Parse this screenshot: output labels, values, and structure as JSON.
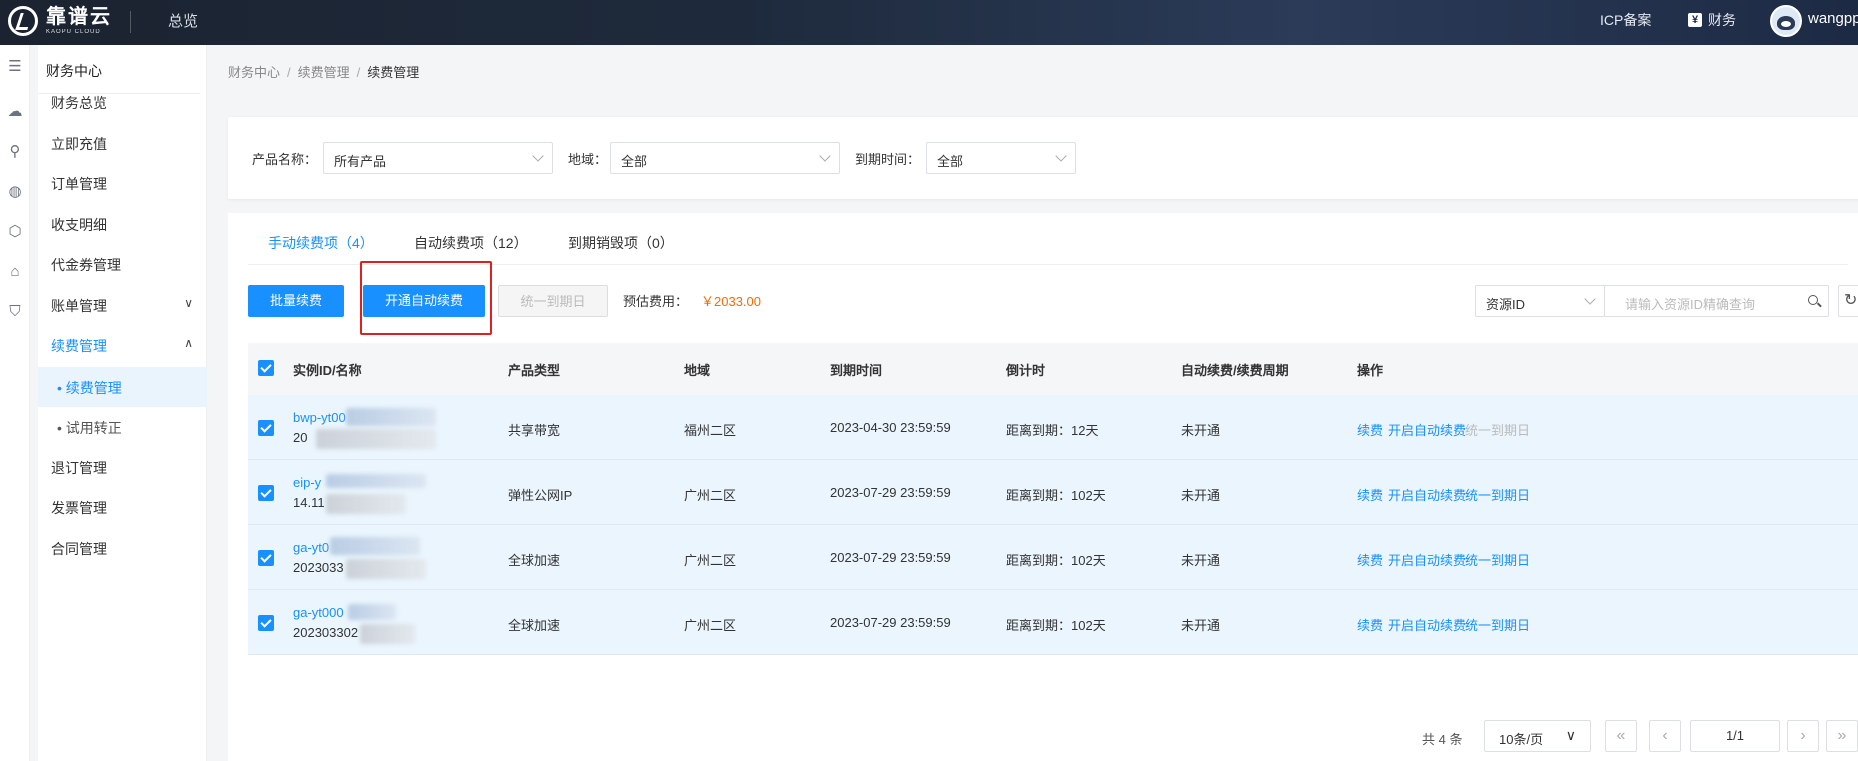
{
  "topbar": {
    "logo_cn": "靠谱云",
    "logo_en": "KAOPU CLOUD",
    "overview": "总览",
    "icp": "ICP备案",
    "finance": "财务",
    "yen_icon": "¥",
    "username": "wangpp"
  },
  "sidebar": {
    "title": "财务中心",
    "items": [
      {
        "label": "财务总览"
      },
      {
        "label": "立即充值"
      },
      {
        "label": "订单管理"
      },
      {
        "label": "收支明细"
      },
      {
        "label": "代金券管理"
      },
      {
        "label": "账单管理"
      },
      {
        "label": "续费管理"
      },
      {
        "label": "退订管理"
      },
      {
        "label": "发票管理"
      },
      {
        "label": "合同管理"
      }
    ],
    "sub_items": [
      {
        "label": "• 续费管理"
      },
      {
        "label": "• 试用转正"
      }
    ]
  },
  "breadcrumb": [
    "财务中心",
    "续费管理",
    "续费管理"
  ],
  "filter": {
    "product_label": "产品名称：",
    "product_value": "所有产品",
    "region_label": "地域：",
    "region_value": "全部",
    "expire_label": "到期时间：",
    "expire_value": "全部"
  },
  "tabs": [
    {
      "label": "手动续费项（4）"
    },
    {
      "label": "自动续费项（12）"
    },
    {
      "label": "到期销毁项（0）"
    }
  ],
  "toolbar": {
    "batch_renew": "批量续费",
    "enable_auto_renew": "开通自动续费",
    "unify_expire": "统一到期日",
    "estimate_label": "预估费用：",
    "estimate_value": "￥2033.00",
    "search_type": "资源ID",
    "search_placeholder": "请输入资源ID精确查询"
  },
  "table": {
    "headers": [
      "实例ID/名称",
      "产品类型",
      "地域",
      "到期时间",
      "倒计时",
      "自动续费/续费周期",
      "操作"
    ],
    "rows": [
      {
        "id": "bwp-yt00",
        "name": "20",
        "type": "共享带宽",
        "region": "福州二区",
        "expire": "2023-04-30 23:59:59",
        "countdown": "距离到期：12天",
        "auto": "未开通",
        "op_renew": "续费",
        "op_auto": "开启自动续费",
        "op_unify": "统一到期日",
        "unify_disabled": true
      },
      {
        "id": "eip-y",
        "name": "14.11",
        "type": "弹性公网IP",
        "region": "广州二区",
        "expire": "2023-07-29 23:59:59",
        "countdown": "距离到期：102天",
        "auto": "未开通",
        "op_renew": "续费",
        "op_auto": "开启自动续费",
        "op_unify": "统一到期日",
        "unify_disabled": false
      },
      {
        "id": "ga-yt0",
        "name": "2023033",
        "type": "全球加速",
        "region": "广州二区",
        "expire": "2023-07-29 23:59:59",
        "countdown": "距离到期：102天",
        "auto": "未开通",
        "op_renew": "续费",
        "op_auto": "开启自动续费",
        "op_unify": "统一到期日",
        "unify_disabled": false
      },
      {
        "id": "ga-yt000",
        "name": "202303302",
        "type": "全球加速",
        "region": "广州二区",
        "expire": "2023-07-29 23:59:59",
        "countdown": "距离到期：102天",
        "auto": "未开通",
        "op_renew": "续费",
        "op_auto": "开启自动续费",
        "op_unify": "统一到期日",
        "unify_disabled": false
      }
    ]
  },
  "pagination": {
    "total": "共 4 条",
    "page_size": "10条/页",
    "current": "1/1"
  },
  "colors": {
    "primary": "#1890ff",
    "highlight_border": "#e02020",
    "estimate": "#f56c00"
  }
}
